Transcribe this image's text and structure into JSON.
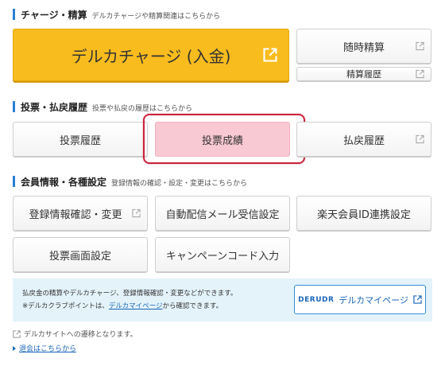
{
  "sections": {
    "charge": {
      "title": "チャージ・精算",
      "subtitle": "デルカチャージや精算関連はこちらから"
    },
    "votes": {
      "title": "投票・払戻履歴",
      "subtitle": "投票や払戻の履歴はこちらから"
    },
    "member": {
      "title": "会員情報・各種設定",
      "subtitle": "登録情報の確認・設定・変更はこちらから"
    }
  },
  "buttons": {
    "delca_charge": "デルカチャージ (入金)",
    "anytime_settlement": "随時精算",
    "settlement_history": "精算履歴",
    "vote_history": "投票履歴",
    "vote_results": "投票成績",
    "payout_history": "払戻履歴",
    "registration_confirm": "登録情報確認・変更",
    "auto_mail_settings": "自動配信メール受信設定",
    "rakuten_link": "楽天会員ID連携設定",
    "vote_screen_settings": "投票画面設定",
    "campaign_code": "キャンペーンコード入力"
  },
  "info": {
    "line1": "払戻金の精算やデルカチャージ、登録情報確認・変更などができます。",
    "line2_pre": "※デルカクラブポイントは、",
    "line2_link": "デルカマイページ",
    "line2_post": "から確認できます。",
    "mypage_logo": "DERUDR",
    "mypage_label": "デルカマイページ"
  },
  "footer": {
    "external_note": "デルカサイトへの遷移となります。",
    "withdraw_link": "退会はこちらから"
  },
  "colors": {
    "accent_bar": "#2a7fd3",
    "charge_yellow": "#f9bc1e",
    "highlight_red": "#c9243b",
    "selected_pink": "#f8c8d3",
    "info_bg": "#e4f3fa"
  }
}
